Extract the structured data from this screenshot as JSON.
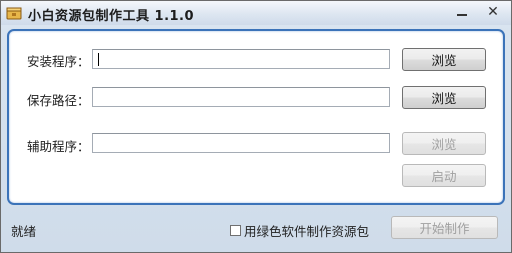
{
  "window": {
    "title": "小白资源包制作工具 1.1.0",
    "minimize_glyph": "",
    "close_glyph": "✕"
  },
  "form": {
    "install_label": "安装程序：",
    "install_value": "",
    "save_label": "保存路径：",
    "save_value": "",
    "aux_label": "辅助程序：",
    "aux_value": "",
    "browse_install": "浏览",
    "browse_save": "浏览",
    "browse_aux": "浏览",
    "launch": "启动"
  },
  "footer": {
    "status": "就绪",
    "green_checkbox_label": "用绿色软件制作资源包",
    "start_button": "开始制作"
  },
  "colors": {
    "panel_border": "#3b73b9",
    "window_bg": "#d8e3ef"
  }
}
